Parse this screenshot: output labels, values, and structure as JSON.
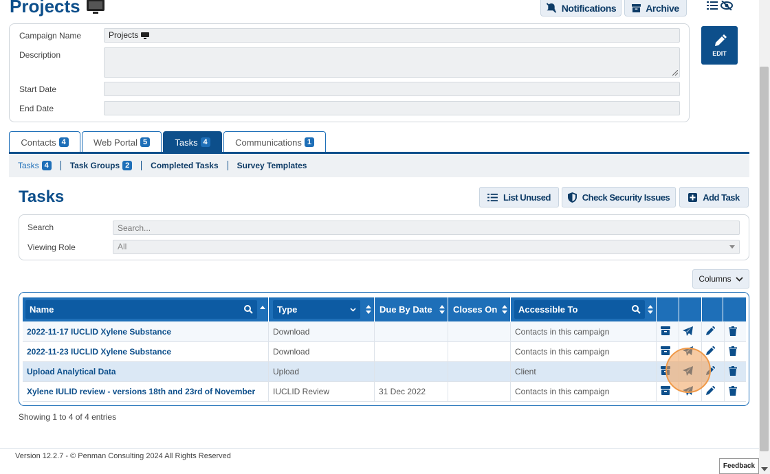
{
  "header": {
    "title": "Projects",
    "notifications": "Notifications",
    "archive": "Archive"
  },
  "form": {
    "campaign_name_label": "Campaign Name",
    "campaign_name_value": "Projects",
    "description_label": "Description",
    "start_date_label": "Start Date",
    "end_date_label": "End Date",
    "edit_label": "EDIT"
  },
  "tabs": [
    {
      "label": "Contacts",
      "count": "4"
    },
    {
      "label": "Web Portal",
      "count": "5"
    },
    {
      "label": "Tasks",
      "count": "4"
    },
    {
      "label": "Communications",
      "count": "1"
    }
  ],
  "subnav": [
    {
      "label": "Tasks",
      "count": "4"
    },
    {
      "label": "Task Groups",
      "count": "2"
    },
    {
      "label": "Completed Tasks"
    },
    {
      "label": "Survey Templates"
    }
  ],
  "tasks": {
    "title": "Tasks",
    "list_unused": "List Unused",
    "check_security": "Check Security Issues",
    "add_task": "Add Task",
    "search_label": "Search",
    "search_placeholder": "Search...",
    "viewing_role_label": "Viewing Role",
    "viewing_role_value": "All",
    "columns_button": "Columns"
  },
  "table": {
    "headers": [
      "Name",
      "Type",
      "Due By Date",
      "Closes On",
      "Accessible To"
    ],
    "rows": [
      {
        "name": "2022-11-17 IUCLID Xylene Substance",
        "type": "Download",
        "due": "",
        "closes": "",
        "access": "Contacts in this campaign"
      },
      {
        "name": "2022-11-23 IUCLID Xylene Substance",
        "type": "Download",
        "due": "",
        "closes": "",
        "access": "Contacts in this campaign"
      },
      {
        "name": "Upload Analytical Data",
        "type": "Upload",
        "due": "",
        "closes": "",
        "access": "Client"
      },
      {
        "name": "Xylene IULID review - versions 18th and 23rd of November",
        "type": "IUCLID Review",
        "due": "31 Dec 2022",
        "closes": "",
        "access": "Contacts in this campaign"
      }
    ],
    "row_actions": [
      "archive-icon",
      "send-icon",
      "pencil-icon",
      "trash-icon"
    ],
    "showing": "Showing 1 to 4 of 4 entries"
  },
  "footer": {
    "text": "Version 12.2.7 - © Penman Consulting 2024 All Rights Reserved",
    "feedback": "Feedback"
  },
  "colors": {
    "primary": "#0d4f8b",
    "accent": "#1e6fb8",
    "highlight": "#f09a4a"
  }
}
